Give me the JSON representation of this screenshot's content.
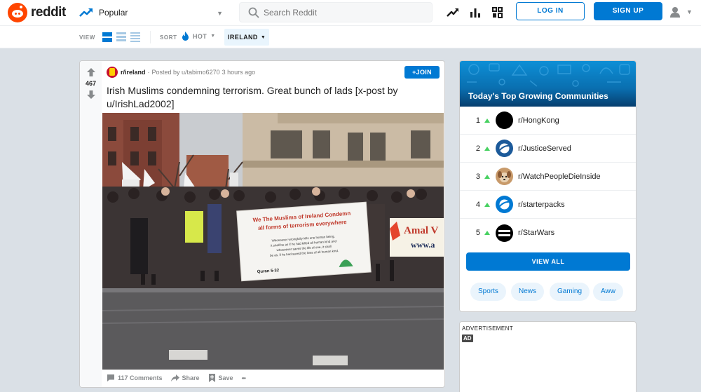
{
  "header": {
    "brand": "reddit",
    "feed": "Popular",
    "search_placeholder": "Search Reddit",
    "login_label": "LOG IN",
    "signup_label": "SIGN UP"
  },
  "subbar": {
    "view_label": "VIEW",
    "sort_label": "SORT",
    "sort_value": "HOT",
    "location": "IRELAND"
  },
  "post": {
    "votes": "467",
    "subreddit": "r/ireland",
    "posted_by": "Posted by u/tabimo6270",
    "time": "3 hours ago",
    "join_label": "+JOIN",
    "title": "Irish Muslims condemning terrorism. Great bunch of lads [x-post by u/IrishLad2002]",
    "image": {
      "banner_line1": "We The Muslims of Ireland Condemn",
      "banner_line2": "all forms of terrorism everywhere",
      "banner_body1": "Whosoever wrongfully kills one human being,",
      "banner_body2": "it shall be as if he had killed all human kind and",
      "banner_body3": "whosoever saves the life of one, it shall",
      "banner_body4": "be as, if he had saved the lives of all human kind.",
      "banner_ref": "Quran 5-32",
      "side_sign1": "Amal V",
      "side_sign2": "www.a"
    },
    "comments_label": "117 Comments",
    "share_label": "Share",
    "save_label": "Save",
    "more_label": "•••"
  },
  "sidebar": {
    "title": "Today's Top Growing Communities",
    "communities": [
      {
        "rank": "1",
        "name": "r/HongKong"
      },
      {
        "rank": "2",
        "name": "r/JusticeServed"
      },
      {
        "rank": "3",
        "name": "r/WatchPeopleDieInside"
      },
      {
        "rank": "4",
        "name": "r/starterpacks"
      },
      {
        "rank": "5",
        "name": "r/StarWars"
      }
    ],
    "view_all_label": "VIEW ALL",
    "tags": [
      "Sports",
      "News",
      "Gaming",
      "Aww"
    ],
    "advert_label": "ADVERTISEMENT",
    "ad_badge": "AD"
  },
  "colors": {
    "brand": "#ff4500",
    "accent": "#0079d3",
    "upvote_trend": "#46d160"
  },
  "icons": {
    "logo": "reddit-alien-icon",
    "feed": "trending-up-icon",
    "search": "search-icon",
    "user": "user-icon"
  }
}
